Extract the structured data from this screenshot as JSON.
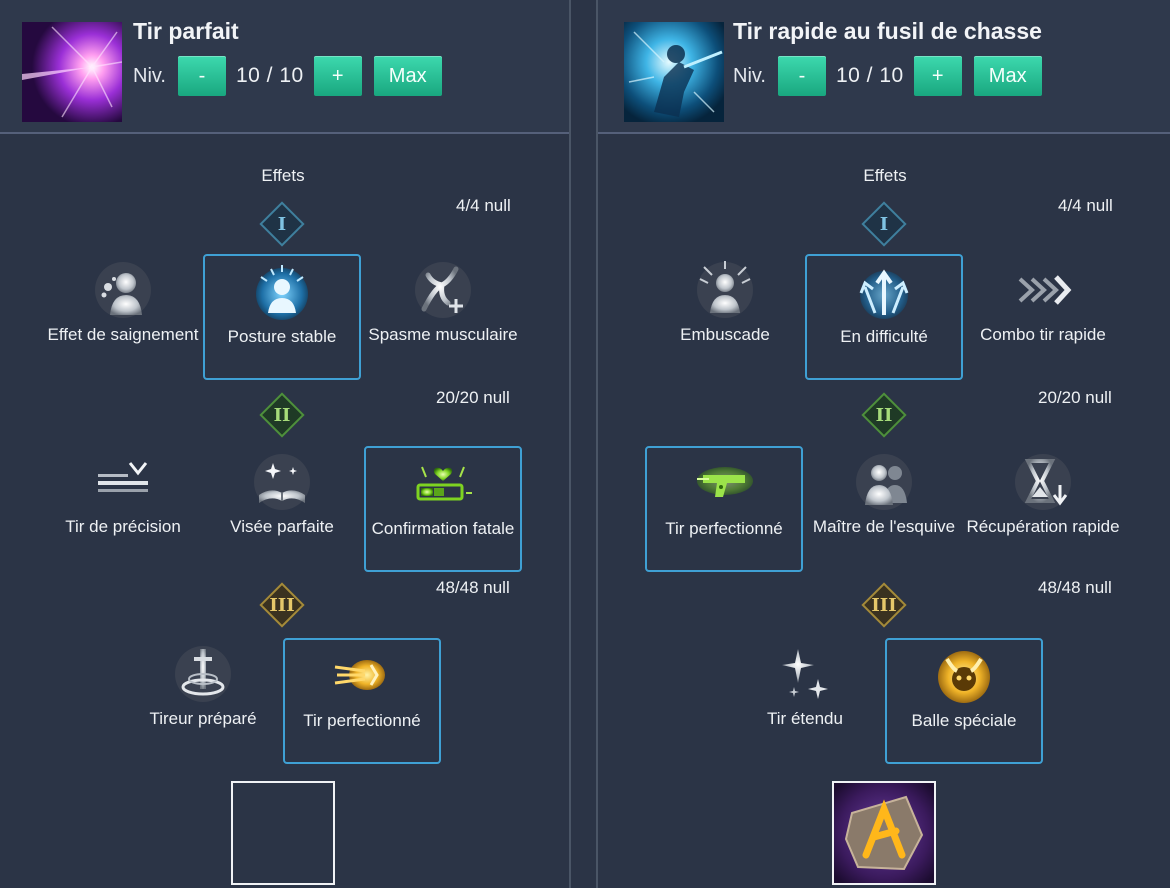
{
  "left": {
    "title": "Tir parfait",
    "niv_label": "Niv.",
    "minus": "-",
    "level": "10 / 10",
    "plus": "+",
    "max": "Max",
    "effets": "Effets",
    "tiers": [
      "I",
      "II",
      "III"
    ],
    "counts": [
      "4/4 null",
      "20/20 null",
      "48/48 null"
    ],
    "row1": [
      "Effet de saignement",
      "Posture stable",
      "Spasme musculaire"
    ],
    "row2": [
      "Tir de précision",
      "Visée parfaite",
      "Confirmation fatale"
    ],
    "row3": [
      "Tireur préparé",
      "Tir perfectionné"
    ]
  },
  "right": {
    "title": "Tir rapide au fusil de chasse",
    "niv_label": "Niv.",
    "minus": "-",
    "level": "10 / 10",
    "plus": "+",
    "max": "Max",
    "effets": "Effets",
    "tiers": [
      "I",
      "II",
      "III"
    ],
    "counts": [
      "4/4 null",
      "20/20 null",
      "48/48 null"
    ],
    "row1": [
      "Embuscade",
      "En difficulté",
      "Combo tir rapide"
    ],
    "row2": [
      "Tir perfectionné",
      "Maître de l'esquive",
      "Récupération rapide"
    ],
    "row3": [
      "Tir étendu",
      "Balle spéciale"
    ]
  },
  "colors": {
    "background": "#2b3446",
    "header": "#2f394c",
    "button": "#1fb48a",
    "selected_border": "#3fa0d4",
    "tier1": "#3f7f9d",
    "tier2": "#4e8f3c",
    "tier3": "#a38a3a"
  },
  "icons": {
    "left_skill": "purple-burst-icon",
    "right_skill": "blue-shooter-icon",
    "rune": "gold-rune-icon"
  }
}
